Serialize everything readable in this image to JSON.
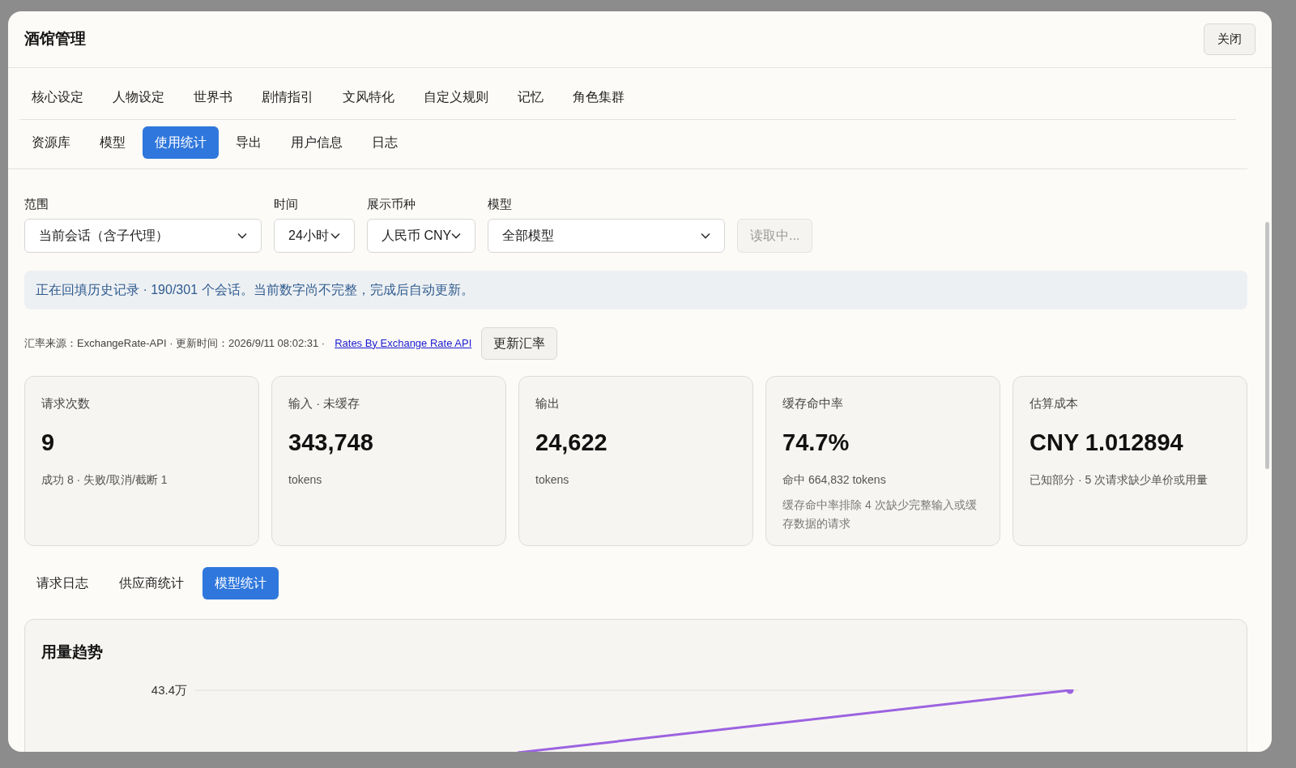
{
  "window": {
    "title": "酒馆管理",
    "close_button": "关闭"
  },
  "tab_rows": [
    [
      {
        "label": "核心设定",
        "selected": false
      },
      {
        "label": "人物设定",
        "selected": false
      },
      {
        "label": "世界书",
        "selected": false
      },
      {
        "label": "剧情指引",
        "selected": false
      },
      {
        "label": "文风特化",
        "selected": false
      },
      {
        "label": "自定义规则",
        "selected": false
      },
      {
        "label": "记忆",
        "selected": false
      },
      {
        "label": "角色集群",
        "selected": false
      }
    ],
    [
      {
        "label": "资源库",
        "selected": false
      },
      {
        "label": "模型",
        "selected": false
      },
      {
        "label": "使用统计",
        "selected": true
      },
      {
        "label": "导出",
        "selected": false
      },
      {
        "label": "用户信息",
        "selected": false
      },
      {
        "label": "日志",
        "selected": false
      }
    ]
  ],
  "filters": [
    {
      "label": "范围",
      "value": "当前会话（含子代理）",
      "kind": "wide"
    },
    {
      "label": "时间",
      "value": "24小时",
      "kind": "narrow"
    },
    {
      "label": "展示币种",
      "value": "人民币 CNY",
      "kind": "medium"
    },
    {
      "label": "模型",
      "value": "全部模型",
      "kind": "wide"
    }
  ],
  "loading_button": {
    "label": "读取中...",
    "disabled": true
  },
  "notice": "正在回填历史记录 · 190/301 个会话。当前数字尚不完整，完成后自动更新。",
  "exchange": {
    "source": "汇率来源：ExchangeRate-API · 更新时间：2026/9/11 08:02:31 ·",
    "link": "Rates By Exchange Rate API",
    "button": "更新汇率"
  },
  "stat_cards": [
    {
      "label": "请求次数",
      "value": "9",
      "notes": [
        "成功 8 · 失败/取消/截断 1"
      ]
    },
    {
      "label": "输入 · 未缓存",
      "value": "343,748",
      "notes": [
        "tokens"
      ]
    },
    {
      "label": "输出",
      "value": "24,622",
      "notes": [
        "tokens"
      ]
    },
    {
      "label": "缓存命中率",
      "value": "74.7%",
      "notes": [
        "命中 664,832 tokens",
        "缓存命中率排除 4 次缺少完整输入或缓存数据的请求"
      ]
    },
    {
      "label": "估算成本",
      "value": "CNY 1.012894",
      "notes": [
        "已知部分 · 5 次请求缺少单价或用量"
      ]
    }
  ],
  "sub_tabs": [
    {
      "label": "请求日志",
      "selected": false
    },
    {
      "label": "供应商统计",
      "selected": false
    },
    {
      "label": "模型统计",
      "selected": true
    }
  ],
  "trend": {
    "title": "用量趋势",
    "y_tick": "43.4万"
  }
}
